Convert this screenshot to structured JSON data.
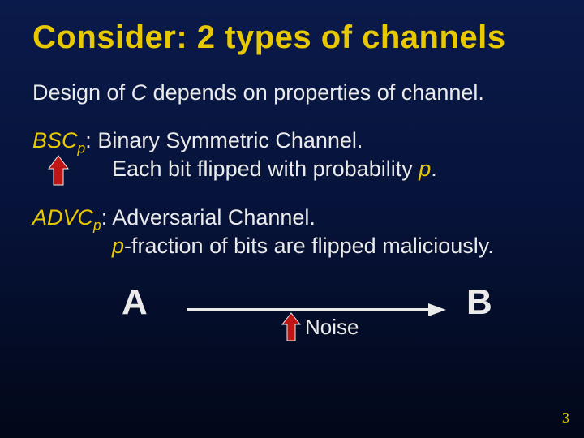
{
  "title": "Consider: 2 types of channels",
  "design_prefix": "Design of ",
  "design_c": "C",
  "design_suffix": " depends on properties of channel.",
  "bsc": {
    "term": "BSC",
    "sub": "p",
    "colon": ": ",
    "line1": "Binary Symmetric Channel.",
    "line2_prefix": "Each bit flipped with probability ",
    "line2_p": "p",
    "line2_suffix": "."
  },
  "advc": {
    "term": "ADVC",
    "sub": "p",
    "colon": ": ",
    "line1": "Adversarial Channel.",
    "line2_prefix": "",
    "line2_p": "p",
    "line2_suffix": "-fraction of bits are flipped maliciously."
  },
  "diagram": {
    "A": "A",
    "B": "B",
    "noise": "Noise"
  },
  "pagenum": "3"
}
